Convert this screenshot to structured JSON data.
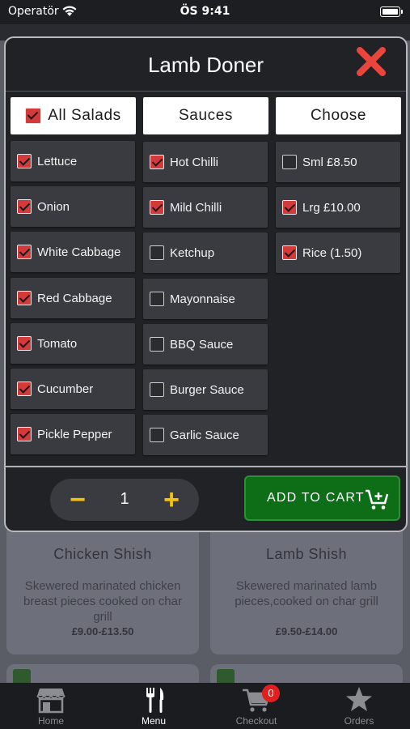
{
  "status_bar": {
    "carrier": "Operatör",
    "time": "ÖS 9:41"
  },
  "background_menu": {
    "cards": [
      {
        "title": "Chicken Shish",
        "description": "Skewered marinated chicken breast pieces cooked on char grill",
        "price": "£9.00-£13.50"
      },
      {
        "title": "Lamb Shish",
        "description": "Skewered marinated lamb pieces,cooked on char grill",
        "price": "£9.50-£14.00"
      }
    ]
  },
  "modal": {
    "title": "Lamb Doner",
    "columns": {
      "salads": {
        "header": "All Salads",
        "header_checked": true,
        "items": [
          {
            "label": "Lettuce",
            "checked": true
          },
          {
            "label": "Onion",
            "checked": true
          },
          {
            "label": "White Cabbage",
            "checked": true
          },
          {
            "label": "Red Cabbage",
            "checked": true
          },
          {
            "label": "Tomato",
            "checked": true
          },
          {
            "label": "Cucumber",
            "checked": true
          },
          {
            "label": "Pickle Pepper",
            "checked": true
          }
        ]
      },
      "sauces": {
        "header": "Sauces",
        "items": [
          {
            "label": "Hot Chilli",
            "checked": true
          },
          {
            "label": "Mild Chilli",
            "checked": true
          },
          {
            "label": "Ketchup",
            "checked": false
          },
          {
            "label": "Mayonnaise",
            "checked": false
          },
          {
            "label": "BBQ Sauce",
            "checked": false
          },
          {
            "label": "Burger Sauce",
            "checked": false
          },
          {
            "label": "Garlic Sauce",
            "checked": false
          }
        ]
      },
      "choose": {
        "header": "Choose",
        "items": [
          {
            "label": "Sml £8.50",
            "checked": false
          },
          {
            "label": "Lrg £10.00",
            "checked": true
          },
          {
            "label": "Rice (1.50)",
            "checked": true
          }
        ]
      }
    },
    "quantity": {
      "minus": "−",
      "value": "1",
      "plus": "+"
    },
    "add_to_cart_label": "ADD TO CART"
  },
  "tab_bar": {
    "tabs": [
      {
        "label": "Home",
        "icon": "store-icon",
        "active": false
      },
      {
        "label": "Menu",
        "icon": "fork-knife-icon",
        "active": true
      },
      {
        "label": "Checkout",
        "icon": "cart-icon",
        "active": false,
        "badge": "0"
      },
      {
        "label": "Orders",
        "icon": "star-icon",
        "active": false
      }
    ]
  },
  "colors": {
    "accent_check": "#d33a3a",
    "cart_button": "#0e6e17",
    "qty_accent": "#f2c20e",
    "close_icon": "#e8453c",
    "badge": "#e02020"
  }
}
